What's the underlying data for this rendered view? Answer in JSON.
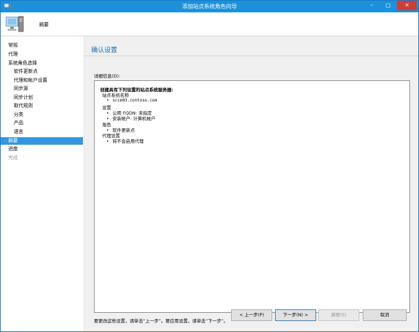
{
  "window": {
    "title": "添加站点系统角色向导"
  },
  "header": {
    "title": "摘要"
  },
  "sidebar": {
    "items": [
      {
        "label": "常规"
      },
      {
        "label": "代理"
      },
      {
        "label": "系统角色选择"
      },
      {
        "label": "软件更新点"
      },
      {
        "label": "代理和帐户设置"
      },
      {
        "label": "同步源"
      },
      {
        "label": "同步计划"
      },
      {
        "label": "取代规则"
      },
      {
        "label": "分类"
      },
      {
        "label": "产品"
      },
      {
        "label": "语言"
      },
      {
        "label": "摘要"
      },
      {
        "label": "进度"
      },
      {
        "label": "完成"
      }
    ]
  },
  "main": {
    "page_title": "确认设置",
    "details_label": "详细信息(D):",
    "details": {
      "heading": "创建具有下列设置的站点系统服务器:",
      "site_system_name_label": "站点系统名称",
      "site_system_name": "sccm03.contoso.com",
      "settings_label": "设置",
      "settings_items": [
        "公用 FQDN: 未指定",
        "安装帐户: 计算机帐户"
      ],
      "roles_label": "角色",
      "roles_items": [
        "软件更新点"
      ],
      "proxy_label": "代理设置",
      "proxy_items": [
        "将不会启用代理"
      ]
    },
    "note": "要更改这些设置，请单击“上一步”。要应用设置，请单击“下一步”。"
  },
  "buttons": {
    "prev": "< 上一步(P)",
    "next": "下一步(N) >",
    "summary": "摘要(S)",
    "cancel": "取消"
  },
  "colors": {
    "titlebar": "#1e90d8",
    "selected": "#3297e0",
    "accent_title": "#1c6fb6"
  }
}
